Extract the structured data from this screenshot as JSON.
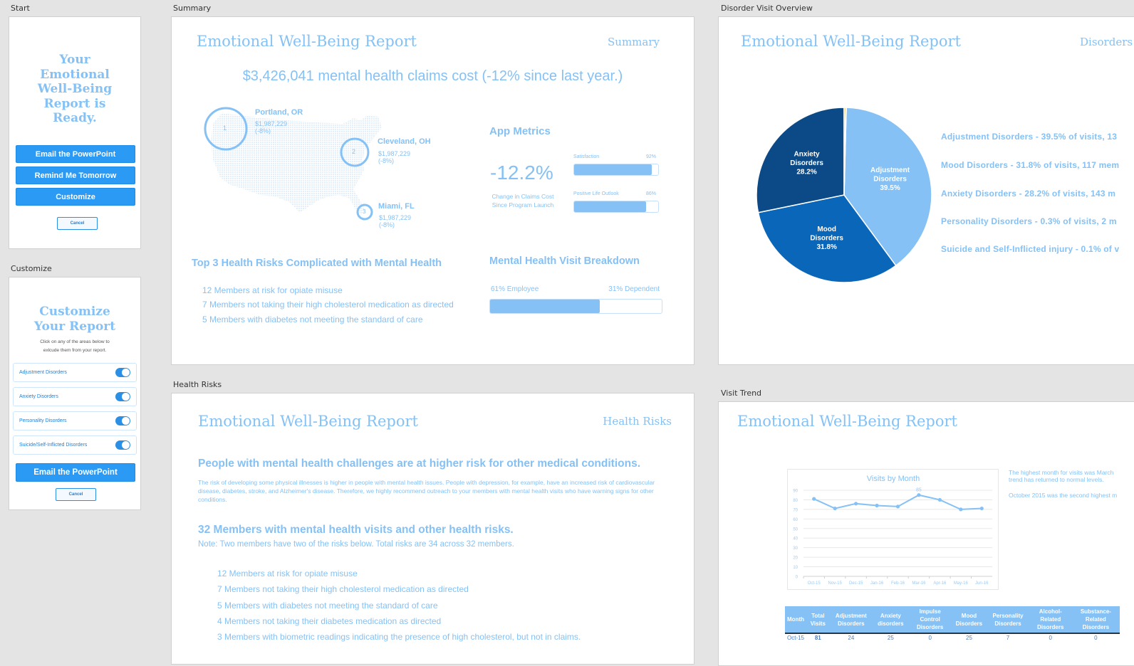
{
  "artboards": {
    "start": "Start",
    "customize": "Customize",
    "summary": "Summary",
    "health_risks": "Health Risks",
    "disorder_overview": "Disorder Visit Overview",
    "visit_trend": "Visit Trend"
  },
  "start": {
    "heading_lines": [
      "Your",
      "Emotional",
      "Well-Being",
      "Report is",
      "Ready."
    ],
    "email_button": "Email the PowerPoint",
    "remind_button": "Remind Me Tomorrow",
    "customize_button": "Customize",
    "cancel_button": "Cancel"
  },
  "customize": {
    "heading_lines": [
      "Customize",
      "Your Report"
    ],
    "instructions_lines": [
      "Click on any of the areas below to",
      "exlcude them from your report."
    ],
    "toggles": [
      {
        "label": "Adjustment Disorders",
        "on": true
      },
      {
        "label": "Anxiety Disorders",
        "on": true
      },
      {
        "label": "Personality Disorders",
        "on": true
      },
      {
        "label": "Suicide/Self-Inflicted Disorders",
        "on": true
      }
    ],
    "email_button": "Email the PowerPoint",
    "cancel_button": "Cancel"
  },
  "report_title": "Emotional Well-Being Report",
  "summary": {
    "section": "Summary",
    "headline": "$3,426,041 mental health claims cost (-12% since last year.)",
    "locations": [
      {
        "rank": "1",
        "city": "Portland, OR",
        "amount": "$1,987,229",
        "change": "(-8%)"
      },
      {
        "rank": "2",
        "city": "Cleveland, OH",
        "amount": "$1,987,229",
        "change": "(-8%)"
      },
      {
        "rank": "3",
        "city": "Miami, FL",
        "amount": "$1,987,229",
        "change": "(-8%)"
      }
    ],
    "app_metrics": {
      "title": "App Metrics",
      "big_value": "-12.2%",
      "big_caption_lines": [
        "Change in Claims Cost",
        "Since Program Launch"
      ],
      "bars": [
        {
          "label": "Satisfaction",
          "value_label": "92%",
          "value": 0.92
        },
        {
          "label": "Positive Life Outlook",
          "value_label": "86%",
          "value": 0.86
        }
      ]
    },
    "top_risks": {
      "title": "Top 3 Health Risks Complicated with Mental Health",
      "items": [
        "12 Members at risk for opiate misuse",
        "7 Members not taking their high cholesterol medication as directed",
        "5 Members with diabetes not meeting the standard of care"
      ]
    },
    "visit_breakdown": {
      "title": "Mental Health Visit Breakdown",
      "left_label": "61% Employee",
      "right_label": "31% Dependent",
      "employee_fraction": 0.64
    }
  },
  "health_risks": {
    "section": "Health Risks",
    "headline": "People with mental health challenges are at higher risk for other medical conditions.",
    "body": "The risk of developing some physical illnesses is higher in people with mental health issues. People with depression, for example, have an increased risk of cardiovascular disease, diabetes, stroke, and Alzheimer's disease. Therefore, we highly recommend outreach to your members with mental health visits who have warning signs for other conditions.",
    "members_headline": "32 Members with mental health visits and other health risks.",
    "note": "Note: Two members have two of the risks below. Total risks are 34 across 32 members.",
    "items": [
      "12 Members at risk for opiate misuse",
      "7 Members not taking their high cholesterol medication as directed",
      "5 Members with diabetes not meeting the standard of care",
      "4 Members not taking their diabetes medication as directed",
      "3 Members with biometric readings indicating the presence of high cholesterol, but not in claims."
    ]
  },
  "disorder_overview": {
    "section": "Disorders",
    "legend": [
      "Adjustment Disorders - 39.5% of visits, 13",
      "Mood Disorders - 31.8% of visits, 117 mem",
      "Anxiety Disorders - 28.2% of visits, 143 m",
      "Personality Disorders - 0.3% of visits, 2 m",
      "Suicide and  Self-Inflicted injury - 0.1% of v"
    ]
  },
  "visit_trend": {
    "notes": [
      "The highest month for visits was March",
      "trend has returned to normal levels.",
      "October 2015 was the second highest m"
    ],
    "table": {
      "headers": [
        "Month",
        "Total Visits",
        "Adjustment Disorders",
        "Anxiety disorders",
        "Impulse Control Disorders",
        "Mood Disorders",
        "Personality Disorders",
        "Alcohol-Related Disorders",
        "Substance-Related Disorders"
      ],
      "rows": [
        [
          "Oct-15",
          "81",
          "24",
          "25",
          "0",
          "25",
          "7",
          "0",
          "0"
        ]
      ]
    }
  },
  "chart_data": [
    {
      "type": "pie",
      "title": "",
      "categories": [
        "Adjustment Disorders",
        "Mood Disorders",
        "Anxiety Disorders",
        "Personality Disorders",
        "Suicide and Self-Inflicted injury"
      ],
      "values": [
        39.5,
        31.8,
        28.2,
        0.3,
        0.1
      ],
      "labels": [
        "Adjustment Disorders 39.5%",
        "Mood Disorders 31.8%",
        "Anxiety Disorders 28.2%",
        "",
        ""
      ],
      "colors": [
        "#85c1f5",
        "#0a66b8",
        "#0b4a86",
        "#f0b400",
        "#cfe5fb"
      ]
    },
    {
      "type": "line",
      "title": "Visits by Month",
      "categories": [
        "Oct-15",
        "Nov-15",
        "Dec-15",
        "Jan-16",
        "Feb-16",
        "Mar-16",
        "Apr-16",
        "May-16",
        "Jun-16"
      ],
      "values": [
        81,
        71,
        76,
        74,
        73,
        85,
        80,
        70,
        71
      ],
      "data_labels": {
        "5": "85"
      },
      "ylim": [
        0,
        90
      ],
      "yticks": [
        0,
        10,
        20,
        30,
        40,
        50,
        60,
        70,
        80,
        90
      ],
      "xlabel": "",
      "ylabel": "",
      "grid": true,
      "color": "#85c1f5"
    }
  ]
}
